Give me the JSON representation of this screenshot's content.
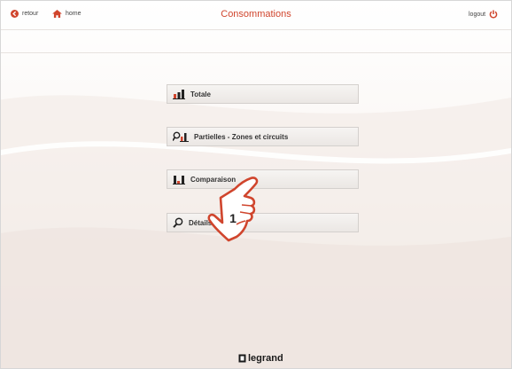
{
  "header": {
    "title": "Consommations",
    "back_label": "retour",
    "home_label": "home",
    "logout_label": "logout"
  },
  "menu": {
    "items": [
      {
        "label": "Totale",
        "icon": "bar-chart-icon"
      },
      {
        "label": "Partielles - Zones et circuits",
        "icon": "search-chart-icon"
      },
      {
        "label": "Comparaison",
        "icon": "comparison-chart-icon"
      },
      {
        "label": "Détails",
        "icon": "magnifier-icon"
      }
    ]
  },
  "annotation": {
    "step_number": "1"
  },
  "footer": {
    "brand": "legrand"
  },
  "colors": {
    "accent": "#d0452d",
    "text": "#333333"
  }
}
